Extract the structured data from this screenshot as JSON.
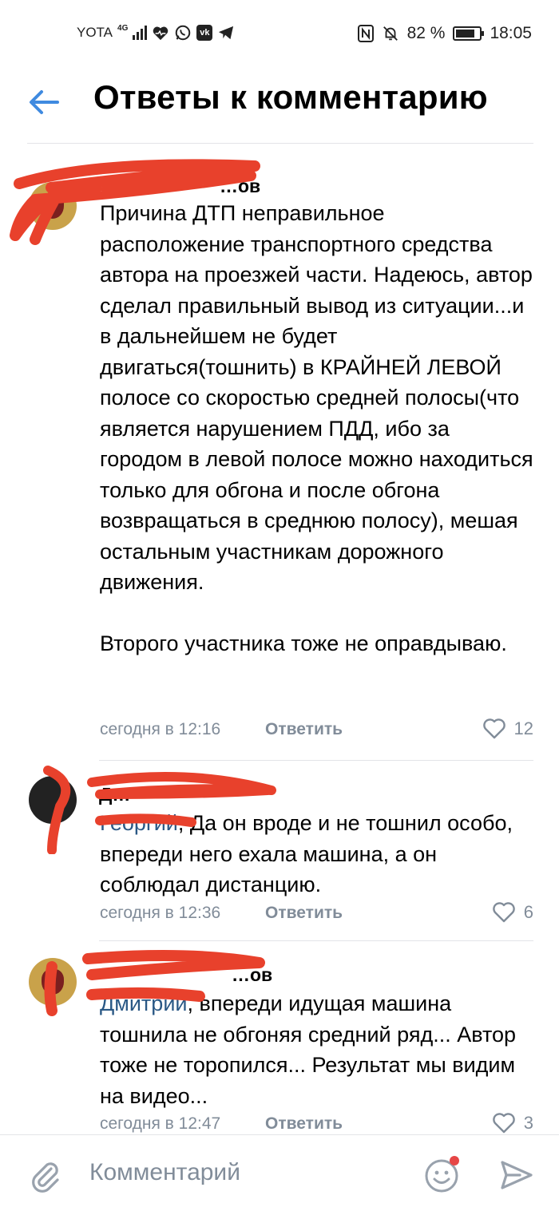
{
  "status_bar": {
    "carrier": "YOTA",
    "network": "4G",
    "battery": "82 %",
    "battery_level": 0.82,
    "time": "18:05",
    "icons": [
      "heart-rate-icon",
      "whatsapp-icon",
      "vk-icon",
      "telegram-icon",
      "nfc-icon",
      "mute-bell-icon",
      "battery-icon"
    ]
  },
  "header": {
    "title": "Ответы к комментарию"
  },
  "comments": [
    {
      "author": "…ов",
      "text": "Причина ДТП неправильное расположение транспортного средства автора на проезжей части. Надеюсь, автор сделал правильный вывод из ситуации...и в дальнейшем не будет двигаться(тошнить) в КРАЙНЕЙ ЛЕВОЙ полосе со скоростью средней полосы(что является нарушением ПДД, ибо за городом в левой полосе можно находиться только для обгона и после обгона возвращаться в среднюю полосу), мешая остальным участникам дорожного движения.\n\nВторого участника тоже не оправдываю.",
      "time": "сегодня в 12:16",
      "reply": "Ответить",
      "likes": "12"
    },
    {
      "author": "Д…",
      "mention": "Георгий",
      "text": ", Да он вроде и не тошнил особо, впереди него ехала машина, а он соблюдал дистанцию.",
      "time": "сегодня в 12:36",
      "reply": "Ответить",
      "likes": "6"
    },
    {
      "author": "…ов",
      "mention": "Дмитрий",
      "text": ", впереди идущая машина тошнила не обгоняя средний ряд... Автор тоже не торопился... Результат мы видим на видео...",
      "time": "сегодня в 12:47",
      "reply": "Ответить",
      "likes": "3"
    }
  ],
  "composer": {
    "placeholder": "Комментарий"
  },
  "colors": {
    "accent": "#2a5885",
    "back_arrow": "#3f8ae0",
    "meta": "#818c99",
    "redaction": "#e8412c",
    "notification_dot": "#e64646"
  }
}
